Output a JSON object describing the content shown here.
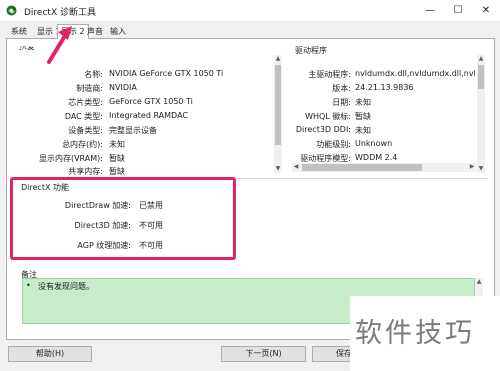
{
  "window": {
    "title": "DirectX 诊断工具",
    "minimize_glyph": "—",
    "maximize_glyph": "☐",
    "close_glyph": "✕"
  },
  "tabs": [
    {
      "label": "系统"
    },
    {
      "label": "显示 1"
    },
    {
      "label": "显示 2",
      "selected": true
    },
    {
      "label": "声音"
    },
    {
      "label": "输入"
    }
  ],
  "device": {
    "title": "设备",
    "rows": [
      {
        "label": "名称:",
        "value": "NVIDIA GeForce GTX 1050 Ti"
      },
      {
        "label": "制造商:",
        "value": "NVIDIA"
      },
      {
        "label": "芯片类型:",
        "value": "GeForce GTX 1050 Ti"
      },
      {
        "label": "DAC 类型:",
        "value": "Integrated RAMDAC"
      },
      {
        "label": "设备类型:",
        "value": "完整显示设备"
      },
      {
        "label": "总内存(约):",
        "value": "未知"
      },
      {
        "label": "显示内存(VRAM):",
        "value": "暂缺"
      },
      {
        "label": "共享内存:",
        "value": "暂缺"
      }
    ]
  },
  "driver": {
    "title": "驱动程序",
    "rows": [
      {
        "label": "主驱动程序:",
        "value": "nvldumdx.dll,nvldumdx.dll,nvldumdx.d"
      },
      {
        "label": "版本:",
        "value": "24.21.13.9836"
      },
      {
        "label": "日期:",
        "value": "未知"
      },
      {
        "label": "WHQL 徽标:",
        "value": "暂缺"
      },
      {
        "label": "Direct3D DDI:",
        "value": "未知"
      },
      {
        "label": "功能级别:",
        "value": "Unknown"
      },
      {
        "label": "驱动程序模型:",
        "value": "WDDM 2.4"
      }
    ]
  },
  "directx": {
    "title": "DirectX 功能",
    "rows": [
      {
        "label": "DirectDraw 加速:",
        "value": "已禁用"
      },
      {
        "label": "Direct3D 加速:",
        "value": "不可用"
      },
      {
        "label": "AGP 纹理加速:",
        "value": "不可用"
      }
    ]
  },
  "notes": {
    "title": "备注",
    "items": [
      "没有发现问题。"
    ]
  },
  "buttons": {
    "help": "帮助(H)",
    "next_page": "下一页(N)",
    "save_all": "保存所"
  },
  "watermark": "软件技巧",
  "colors": {
    "highlight": "#e0245e",
    "notes_bg": "#c7eccc",
    "title_icon": "#2a7a2a"
  }
}
